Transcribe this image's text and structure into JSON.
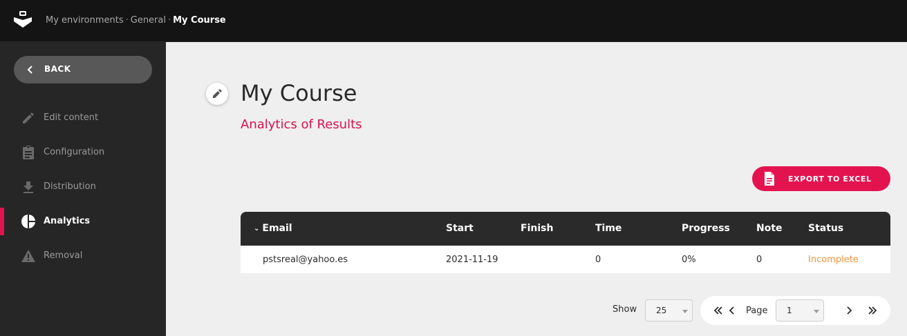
{
  "breadcrumb": {
    "items": [
      "My environments",
      "General"
    ],
    "separator": "·",
    "current": "My Course"
  },
  "sidebar": {
    "back_label": "BACK",
    "items": [
      {
        "label": "Edit content",
        "icon": "pencil-icon"
      },
      {
        "label": "Configuration",
        "icon": "clipboard-icon"
      },
      {
        "label": "Distribution",
        "icon": "download-icon"
      },
      {
        "label": "Analytics",
        "icon": "pie-chart-icon",
        "active": true
      },
      {
        "label": "Removal",
        "icon": "warning-icon"
      }
    ]
  },
  "main": {
    "title": "My Course",
    "subtitle": "Analytics of Results",
    "export_label": "EXPORT TO EXCEL"
  },
  "table": {
    "columns": [
      "Email",
      "Start",
      "Finish",
      "Time",
      "Progress",
      "Note",
      "Status"
    ],
    "rows": [
      {
        "email": "pstsreal@yahoo.es",
        "start": "2021-11-19",
        "finish": "",
        "time": "0",
        "progress": "0%",
        "note": "0",
        "status": "Incomplete"
      }
    ]
  },
  "pagination": {
    "show_label": "Show",
    "per_page": "25",
    "page_label": "Page",
    "page": "1"
  },
  "colors": {
    "accent": "#e3134f",
    "status_incomplete": "#f0923a",
    "topbar": "#141414",
    "sidebar": "#262626"
  }
}
